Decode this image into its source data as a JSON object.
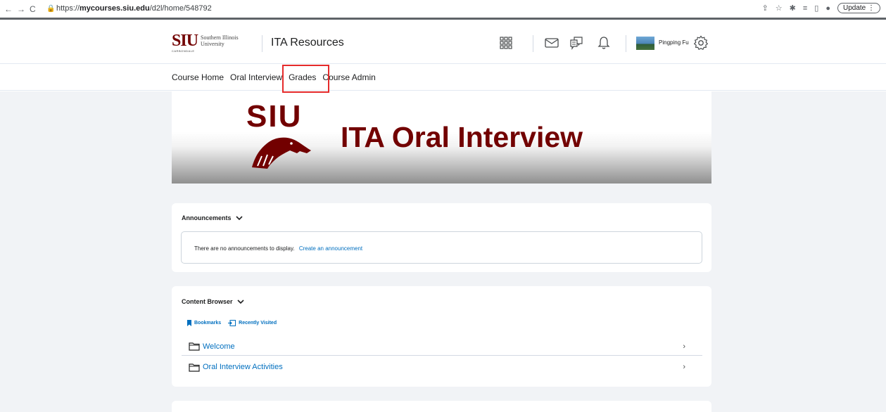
{
  "browser": {
    "url_prefix": "https://",
    "url_domain": "mycourses.siu.edu",
    "url_path": "/d2l/home/548792",
    "update_label": "Update"
  },
  "header": {
    "logo_text": "SIU",
    "logo_sub_line1": "Southern Illinois",
    "logo_sub_line2": "University",
    "logo_carbondale": "CARBONDALE",
    "course_name": "ITA Resources",
    "user_name": "Pingping Fu"
  },
  "nav": {
    "items": [
      "Course Home",
      "Oral Interview",
      "Grades",
      "Course Admin"
    ]
  },
  "banner": {
    "logo_text": "SIU",
    "title": "ITA Oral Interview"
  },
  "announcements": {
    "title": "Announcements",
    "empty_text": "There are no announcements to display.",
    "create_link": "Create an announcement"
  },
  "content_browser": {
    "title": "Content Browser",
    "bookmarks_label": "Bookmarks",
    "recent_label": "Recently Visited",
    "modules": [
      "Welcome",
      "Oral Interview Activities"
    ]
  },
  "colors": {
    "brand": "#720000",
    "link": "#006fbf",
    "highlight": "#e52b2b"
  }
}
